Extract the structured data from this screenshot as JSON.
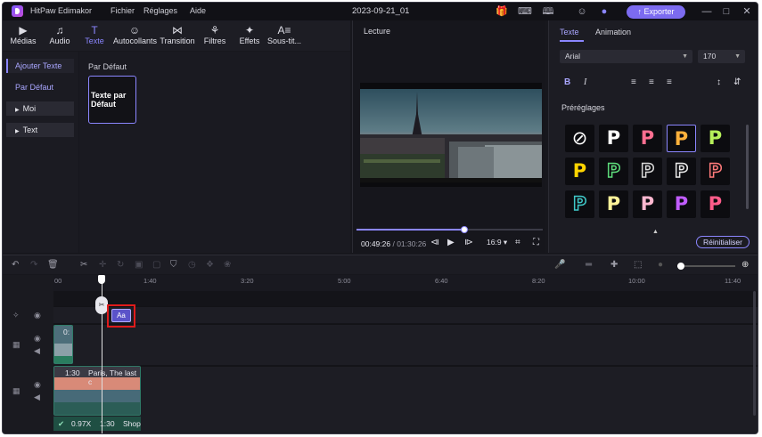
{
  "app": {
    "name": "HitPaw Edimakor",
    "menus": [
      "Fichier",
      "Réglages",
      "Aide"
    ],
    "document_title": "2023-09-21_01",
    "export_label": "Exporter"
  },
  "toolbar": {
    "tabs": [
      {
        "label": "Médias",
        "icon": "media-icon"
      },
      {
        "label": "Audio",
        "icon": "music-icon"
      },
      {
        "label": "Texte",
        "icon": "text-icon"
      },
      {
        "label": "Autocollants",
        "icon": "sticker-icon"
      },
      {
        "label": "Transition",
        "icon": "transition-icon"
      },
      {
        "label": "Filtres",
        "icon": "filter-icon"
      },
      {
        "label": "Effets",
        "icon": "effects-icon"
      },
      {
        "label": "Sous-tit...",
        "icon": "subtitle-icon"
      }
    ],
    "active": "Texte"
  },
  "left_nav": {
    "items": [
      "Ajouter Texte",
      "Par Défaut",
      "Moi",
      "Text"
    ]
  },
  "content": {
    "section_label": "Par Défaut",
    "preset_card": "Texte par Défaut"
  },
  "preview": {
    "title": "Lecture",
    "time_current": "00:49:26",
    "time_total": "/ 01:30:26",
    "aspect": "16:9",
    "progress": 0.58
  },
  "properties": {
    "tabs": [
      "Texte",
      "Animation"
    ],
    "font": "Arial",
    "font_size": "170",
    "bold_label": "B",
    "italic_label": "I",
    "presets_label": "Préréglages",
    "reset_label": "Réinitialiser",
    "preset_colors": [
      [
        "none",
        "#ffffff",
        "#ff6f91",
        "#ffb13b",
        "#b6f05a"
      ],
      [
        "#ffd400",
        "#5ddc7b",
        "#d8d8d8",
        "#e8e8e8",
        "#ff7a7a"
      ],
      [
        "#3fc8c8",
        "#fff39a",
        "#ffb8d0",
        "#c15cff",
        "#ff5c8a"
      ]
    ]
  },
  "timeline": {
    "ruler_ticks": [
      "00",
      "1:40",
      "3:20",
      "5:00",
      "6:40",
      "8:20",
      "10:00",
      "11:40"
    ],
    "clip_top_label": "0:",
    "clip_main": {
      "time": "1:30",
      "title": "Paris, The last c"
    },
    "audio_info": {
      "speed": "0.97X",
      "time": "1:30",
      "name": "Shop"
    },
    "text_clip_label": "Aa",
    "zoom": 0.06
  }
}
